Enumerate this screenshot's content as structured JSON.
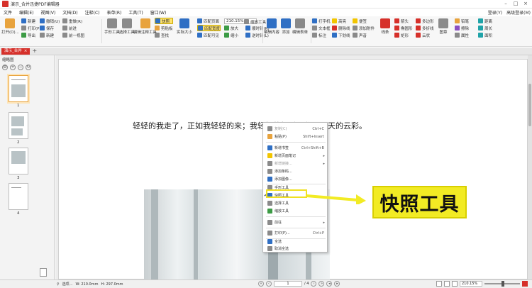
{
  "window": {
    "title": "演示_合并迅捷PDF编辑器",
    "right_links": [
      "客服(V)",
      "高级版(P)"
    ]
  },
  "menubar": {
    "items": [
      "文件",
      "编辑(E)",
      "视图(V)",
      "文档(D)",
      "注释(C)",
      "表单(R)",
      "工具(T)",
      "窗口(W)"
    ],
    "right": [
      "登录(Y)",
      "高级登录(M)"
    ]
  },
  "ribbon": {
    "open_label": "打开(O)...",
    "group1": [
      "新建",
      "打印(P)",
      "导出"
    ],
    "group2": [
      "撤销(U)",
      "保存",
      "新建"
    ],
    "group3": [
      "重做(R)",
      "前进",
      "前一视图"
    ],
    "hand_tool": "手形工具",
    "select_tool": "选择工具",
    "edit_tool": "编辑注释工具",
    "snapshot": "快照",
    "clipboard": "剪贴板",
    "find": "查找",
    "actual_size": "实际大小",
    "fit_page": "匹配页面",
    "fit_width": "匹配宽度",
    "fit_visible": "匹配可见",
    "zoom_value": "210.15%",
    "zoom_in": "放大",
    "zoom_out": "缩小",
    "zoom_tool": "缩放工具",
    "rotate_cw": "顺时针(R)",
    "rotate_ccw": "逆时针(L)",
    "edit_content": "编辑内容",
    "add": "添加",
    "edit_form": "编辑表单",
    "typewriter": "打字机",
    "textbox": "文本框",
    "callout": "标注",
    "highlight": "高亮",
    "strikeout": "删除线",
    "underline": "下划线",
    "sticky_note": "便签",
    "attach_file": "添加附件",
    "sound": "声音",
    "line": "线条",
    "arrow": "箭头",
    "oval": "椭圆形",
    "rect": "矩形",
    "polygon": "多边形",
    "polyline": "多折线",
    "cloud": "云状",
    "stamp": "图章",
    "pencil": "铅笔",
    "eraser": "擦除",
    "measure": "距离",
    "perimeter": "周长",
    "area": "面积",
    "properties": "属性"
  },
  "tabs": {
    "doc_tab": "演示_合并",
    "add_tab": "+"
  },
  "sidepanel": {
    "title": "缩略图",
    "pages": [
      "1",
      "2",
      "3",
      "4"
    ]
  },
  "document": {
    "poem": "轻轻的我走了，正如我轻轻的来；我轻轻的招手，作别西天的云彩。"
  },
  "context_menu": {
    "items": [
      {
        "label": "复制(C)",
        "shortcut": "Ctrl+C",
        "disabled": true
      },
      {
        "label": "粘贴(P)",
        "shortcut": "Shift+Insert",
        "disabled": false
      },
      {
        "label": "新增书签",
        "shortcut": "Ctrl+Shift+B",
        "disabled": false
      },
      {
        "label": "新增页面笔记",
        "shortcut": "",
        "disabled": false
      },
      {
        "label": "新增链接...",
        "shortcut": "",
        "disabled": true
      },
      {
        "label": "添加条码...",
        "shortcut": "",
        "disabled": false
      },
      {
        "label": "添加图像...",
        "shortcut": "",
        "disabled": false
      },
      {
        "label": "手形工具",
        "shortcut": "",
        "disabled": false
      },
      {
        "label": "快照工具",
        "shortcut": "",
        "disabled": false
      },
      {
        "label": "选择工具",
        "shortcut": "",
        "disabled": false
      },
      {
        "label": "缩放工具",
        "shortcut": "",
        "disabled": false
      },
      {
        "label": "前往",
        "shortcut": "",
        "disabled": false
      },
      {
        "label": "打印(P)...",
        "shortcut": "Ctrl+P",
        "disabled": false
      },
      {
        "label": "全选",
        "shortcut": "",
        "disabled": false
      },
      {
        "label": "取消全选",
        "shortcut": "",
        "disabled": false
      }
    ]
  },
  "callout": {
    "text": "快照工具"
  },
  "statusbar": {
    "options": "选项...",
    "width": "W: 210.0mm",
    "height": "H: 297.0mm",
    "page_value": "1",
    "page_total": "/ 4",
    "zoom": "210.15%"
  },
  "colors": {
    "accent_red": "#d6302a",
    "callout_yellow": "#f2eb24",
    "selection_orange": "#e8a33d"
  }
}
